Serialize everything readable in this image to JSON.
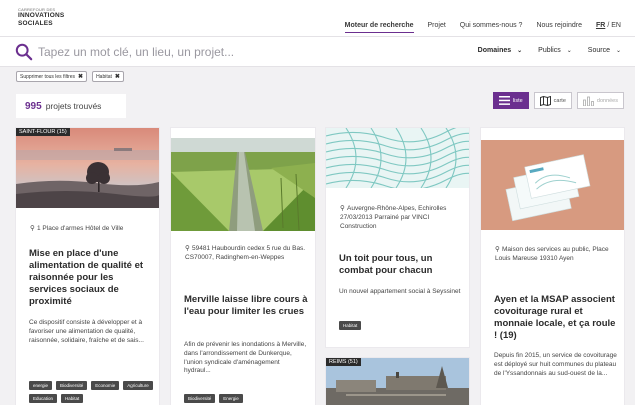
{
  "header": {
    "logo_sup": "CARREFOUR DES",
    "logo_line1": "INNOVATIONS",
    "logo_line2": "SOCIALES",
    "nav": [
      "Moteur de recherche",
      "Projet",
      "Qui sommes-nous ?",
      "Nous rejoindre"
    ],
    "lang_fr": "FR",
    "lang_sep": "/",
    "lang_en": "EN"
  },
  "search": {
    "placeholder": "Tapez un mot clé, un lieu, un projet...",
    "filters": [
      "Domaines",
      "Publics",
      "Source"
    ]
  },
  "active_filters": [
    "Supprimer tous les filtres",
    "Habitat"
  ],
  "results": {
    "count": "995",
    "label": "projets trouvés"
  },
  "views": [
    "liste",
    "carte",
    "données"
  ],
  "cards": [
    {
      "badge": "SAINT-FLOUR (15)",
      "location": "1 Place d'armes Hôtel de Ville",
      "title": "Mise en place d'une alimentation de qualité et raisonnée pour les services sociaux de proximité",
      "description": "Ce dispositif consiste à développer et à favoriser une alimentation de qualité, raisonnée, solidaire, fraîche et de sais...",
      "tags": [
        "energie",
        "Biodiversité",
        "Economie",
        "Agriculture",
        "Education",
        "Habitat"
      ]
    },
    {
      "location": "59481 Haubourdin cedex 5 rue du Bas. CS70007, Radinghem-en-Weppes",
      "title": "Merville laisse libre cours à l'eau pour limiter les crues",
      "description": "Afin de prévenir les inondations à Merville, dans l'arrondissement de Dunkerque, l'union syndicale d'aménagement hydraul...",
      "tags": [
        "Biodiversité",
        "Energie"
      ]
    },
    {
      "location": "Auvergne-Rhône-Alpes, Echirolles 27/03/2013 Parrainé par VINCI Construction",
      "title": "Un toit pour tous, un combat pour chacun",
      "description": "Un nouvel appartement social à Seyssinet",
      "tags": [
        "Habitat"
      ]
    },
    {
      "badge": "REIMS (51)"
    },
    {
      "location": "Maison des services au public, Place Louis Mareuse 19310 Ayen",
      "title": "Ayen et la MSAP associent covoiturage rural et monnaie locale, et ça roule ! (19)",
      "description": "Depuis fin 2015, un service de covoiturage est déployé sur huit communes du plateau de l'Yssandonnais au sud-ouest de la..."
    }
  ],
  "colors": {
    "accent": "#6b2f8f"
  }
}
